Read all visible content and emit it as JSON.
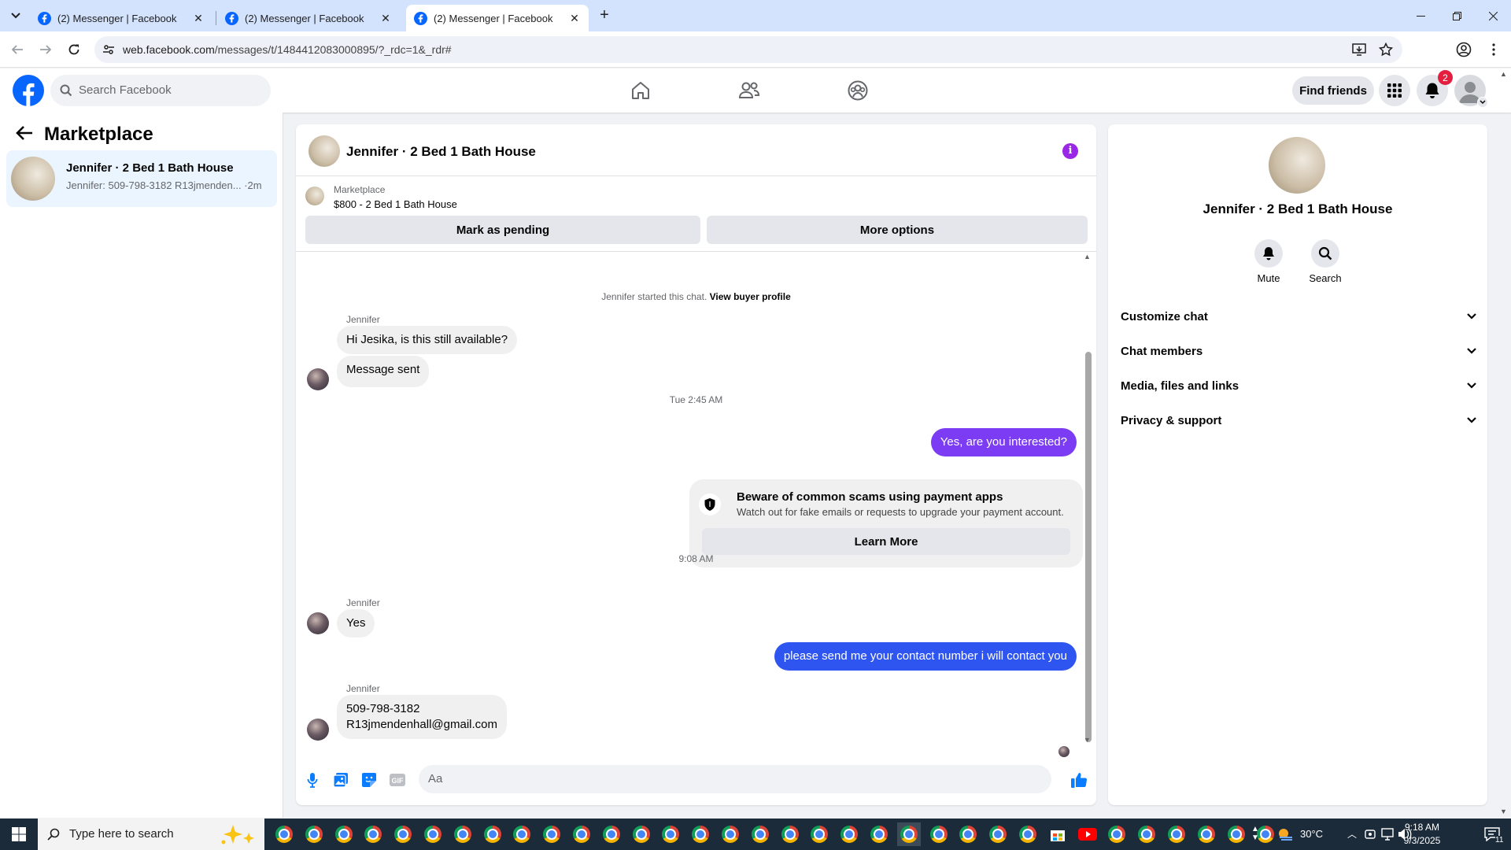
{
  "browser": {
    "tabs": [
      {
        "title": "(2) Messenger | Facebook",
        "active": false
      },
      {
        "title": "(2) Messenger | Facebook",
        "active": false
      },
      {
        "title": "(2) Messenger | Facebook",
        "active": true
      }
    ],
    "url_host": "web.facebook.com",
    "url_path": "/messages/t/1484412083000895/?_rdc=1&_rdr#"
  },
  "header": {
    "search_placeholder": "Search Facebook",
    "find_friends": "Find friends",
    "notification_count": "2",
    "nav_icons": [
      "home-icon",
      "friends-icon",
      "groups-icon"
    ],
    "brand_color": "#0866ff"
  },
  "sidebar": {
    "title": "Marketplace",
    "conversations": [
      {
        "name": "Jennifer · 2 Bed 1 Bath House",
        "preview": "Jennifer: 509-798-3182 R13jmenden...",
        "time": "·2m"
      }
    ]
  },
  "chat": {
    "title": "Jennifer · 2 Bed 1 Bath House",
    "listing": {
      "source": "Marketplace",
      "price_title": "$800 - 2 Bed 1 Bath House"
    },
    "buttons": {
      "mark_pending": "Mark as pending",
      "more_options": "More options"
    },
    "started": "Jennifer started this chat.",
    "view_profile": "View buyer profile",
    "messages": [
      {
        "sender": "Jennifer",
        "text": "Hi Jesika, is this still available?"
      },
      {
        "text": "Message sent"
      },
      {
        "timestamp": "Tue 2:45 AM"
      },
      {
        "outgoing": true,
        "text": "Yes, are you interested?"
      },
      {
        "timestamp": "9:08 AM"
      },
      {
        "sender": "Jennifer",
        "text": "Yes"
      },
      {
        "outgoing": true,
        "text": "please send me your contact number i will contact you"
      },
      {
        "sender": "Jennifer",
        "line1": "509-798-3182",
        "line2": "R13jmendenhall@gmail.com"
      }
    ],
    "scam_warning": {
      "title": "Beware of common scams using payment apps",
      "subtitle": "Watch out for fake emails or requests to upgrade your payment account.",
      "button": "Learn More"
    },
    "composer_placeholder": "Aa",
    "outgoing_color": "#7b3cf3",
    "outgoing_color_2": "#2f55f0"
  },
  "info_panel": {
    "name": "Jennifer · 2 Bed 1 Bath House",
    "actions": [
      {
        "label": "Mute"
      },
      {
        "label": "Search"
      }
    ],
    "sections": [
      "Customize chat",
      "Chat members",
      "Media, files and links",
      "Privacy & support"
    ]
  },
  "taskbar": {
    "search_placeholder": "Type here to search",
    "temperature": "30°C",
    "time": "9:18 AM",
    "date": "9/3/2025",
    "notif_count": "11"
  }
}
